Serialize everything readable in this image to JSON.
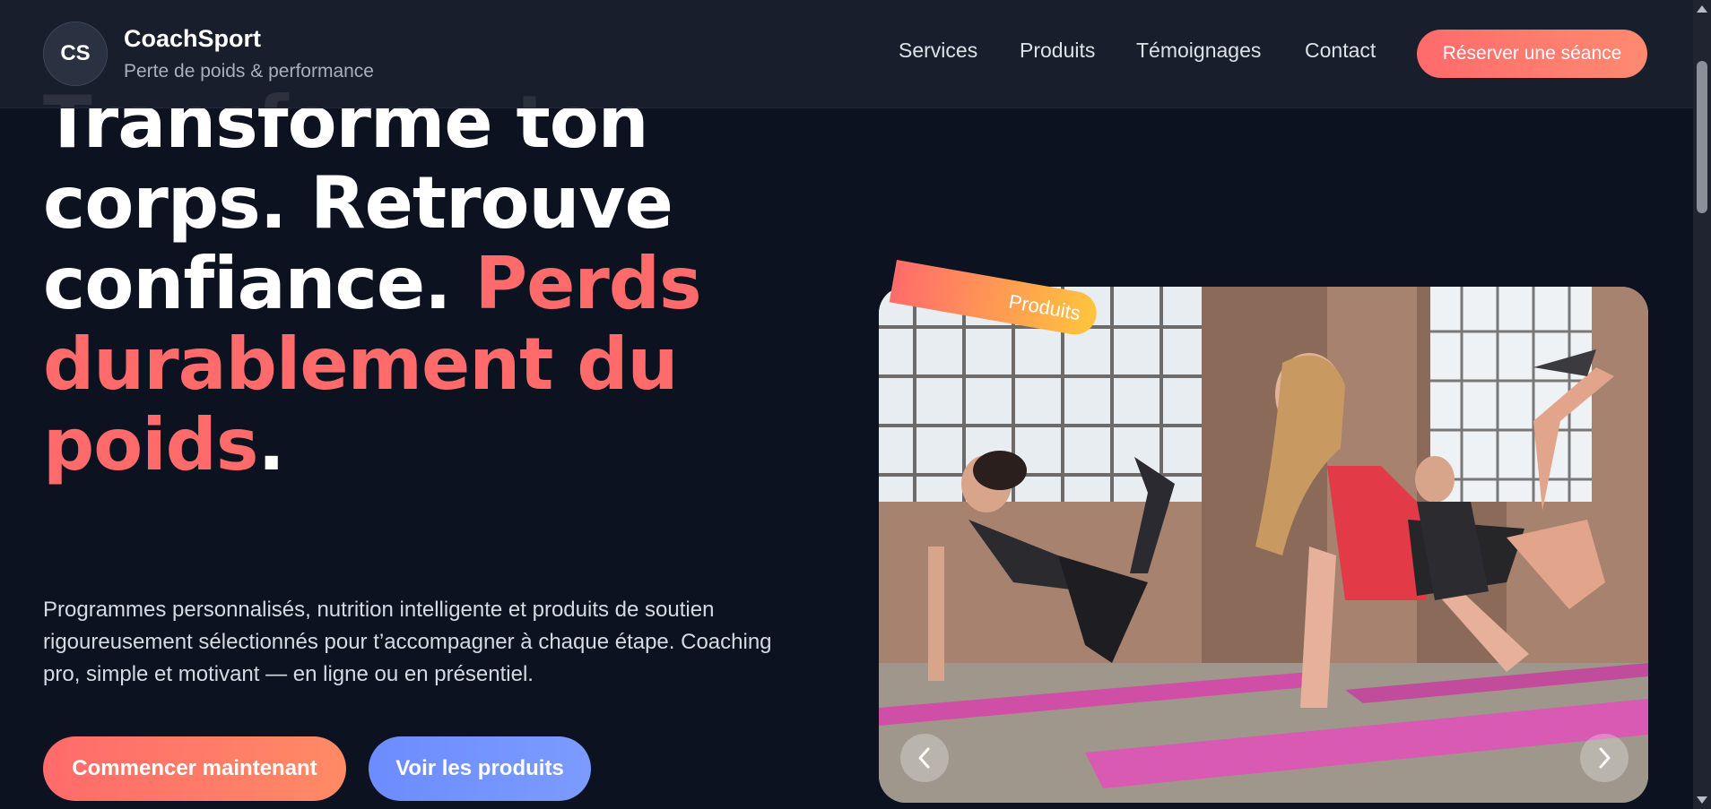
{
  "header": {
    "logo_initials": "CS",
    "brand_name": "CoachSport",
    "brand_tagline": "Perte de poids & performance",
    "nav": [
      "Services",
      "Produits",
      "Témoignages",
      "Contact"
    ],
    "cta_label": "Réserver une séance"
  },
  "hero": {
    "title_part1": "Transforme ton corps. Retrouve confiance.",
    "title_accent": "Perds durablement du poids",
    "title_end": ".",
    "subtitle": "Programmes personnalisés, nutrition intelligente et produits de soutien rigoureusement sélectionnés pour t’accompagner à chaque étape. Coaching pro, simple et motivant — en ligne ou en présentiel.",
    "primary_button": "Commencer maintenant",
    "secondary_button": "Voir les produits"
  },
  "carousel": {
    "badge_label": "Produits",
    "prev_icon": "chevron-left-icon",
    "next_icon": "chevron-right-icon"
  },
  "colors": {
    "accent": "#ff6b6b",
    "secondary_button": "#6c8cff",
    "background": "#0c1220"
  }
}
